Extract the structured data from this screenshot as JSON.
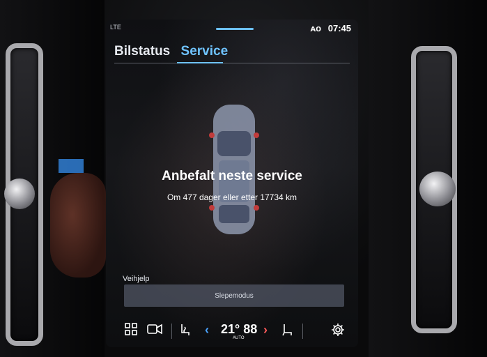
{
  "status_bar": {
    "signal": "LTE",
    "indicator": "ᴀᴏ",
    "time": "07:45"
  },
  "tabs": [
    {
      "label": "Bilstatus",
      "active": false
    },
    {
      "label": "Service",
      "active": true
    }
  ],
  "service": {
    "title": "Anbefalt neste service",
    "subtitle": "Om 477 dager eller etter 17734 km"
  },
  "roadside": {
    "label": "Veihjelp",
    "tow_mode_button": "Slepemodus"
  },
  "climate_bar": {
    "temperature": "21° 88",
    "mode": "AUTO",
    "icons": [
      "apps-grid-icon",
      "camera-icon",
      "seat-heat-icon",
      "chevron-left-icon",
      "chevron-right-icon",
      "seat-icon",
      "settings-icon"
    ],
    "colors": {
      "left_chevron": "#4aa3ff",
      "right_chevron": "#ff5a5a"
    }
  },
  "colors": {
    "accent": "#6fc3ff",
    "tab_text": "#e6e9ef"
  }
}
